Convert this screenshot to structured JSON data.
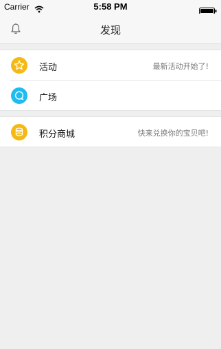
{
  "status_bar": {
    "carrier": "Carrier",
    "time": "5:58 PM",
    "wifi_icon": "wifi-icon",
    "battery_icon": "battery-icon"
  },
  "nav": {
    "title": "发现",
    "left_icon": "bell-icon"
  },
  "groups": [
    {
      "rows": [
        {
          "label": "活动",
          "detail": "最新活动开始了!",
          "icon": "star-icon",
          "icon_color": "#f5b914"
        },
        {
          "label": "广场",
          "detail": "",
          "icon": "chat-icon",
          "icon_color": "#1ebcf0"
        }
      ]
    },
    {
      "rows": [
        {
          "label": "积分商城",
          "detail": "快来兑换你的宝贝吧!",
          "icon": "coins-icon",
          "icon_color": "#f5b914"
        }
      ]
    }
  ],
  "colors": {
    "background": "#efefef",
    "bar": "#f7f7f7",
    "yellow_accent": "#f5b914",
    "blue_accent": "#1ebcf0"
  }
}
